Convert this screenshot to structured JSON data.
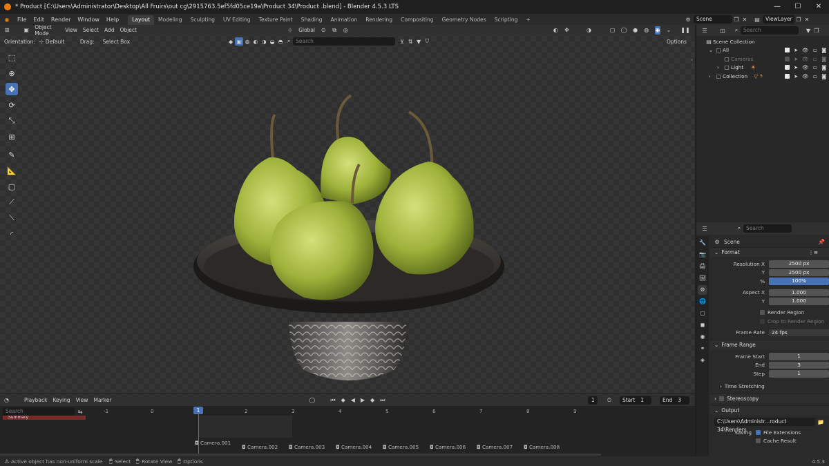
{
  "titlebar": {
    "title": "* Product [C:\\Users\\Administrator\\Desktop\\All Fruirs\\out cg\\2915763.5ef5fd05ce19a\\Product 34\\Product .blend] - Blender 4.5.3 LTS",
    "minimize": "—",
    "maximize": "☐",
    "close": "✕"
  },
  "menu": [
    "File",
    "Edit",
    "Render",
    "Window",
    "Help"
  ],
  "workspaces": [
    "Layout",
    "Modeling",
    "Sculpting",
    "UV Editing",
    "Texture Paint",
    "Shading",
    "Animation",
    "Rendering",
    "Compositing",
    "Geometry Nodes",
    "Scripting"
  ],
  "add_workspace": "+",
  "scene_name": "Scene",
  "view_layer": "ViewLayer",
  "viewport_header": {
    "mode": "Object Mode",
    "menus": [
      "View",
      "Select",
      "Add",
      "Object"
    ],
    "transform_orientation": "Global"
  },
  "tool_settings": {
    "orientation_label": "Orientation:",
    "orientation_value": "Default",
    "drag_label": "Drag:",
    "drag_value": "Select Box",
    "search_placeholder": "Search",
    "options": "Options"
  },
  "outliner": {
    "search_placeholder": "Search",
    "scene_collection": "Scene Collection",
    "items": [
      {
        "label": "All"
      },
      {
        "label": "Cameras"
      },
      {
        "label": "Light"
      },
      {
        "label": "Collection"
      }
    ],
    "collection_badge": "5"
  },
  "properties": {
    "search_placeholder": "Search",
    "context": "Scene",
    "format": {
      "header": "Format",
      "resolution_x_label": "Resolution X",
      "resolution_x": "2500 px",
      "resolution_y_label": "Y",
      "resolution_y": "2500 px",
      "percent_label": "%",
      "percent": "100%",
      "aspect_x_label": "Aspect X",
      "aspect_x": "1.000",
      "aspect_y_label": "Y",
      "aspect_y": "1.000",
      "render_region": "Render Region",
      "crop_region": "Crop to Render Region",
      "frame_rate_label": "Frame Rate",
      "frame_rate": "24 fps"
    },
    "frame_range": {
      "header": "Frame Range",
      "start_label": "Frame Start",
      "start": "1",
      "end_label": "End",
      "end": "3",
      "step_label": "Step",
      "step": "1"
    },
    "time_stretching": "Time Stretching",
    "stereoscopy": "Stereoscopy",
    "output": {
      "header": "Output",
      "path": "C:\\Users\\Administr...roduct 34\\Renders",
      "saving_label": "Saving",
      "file_extensions": "File Extensions",
      "cache_result": "Cache Result"
    }
  },
  "timeline": {
    "menus": [
      "Playback",
      "Keying",
      "View",
      "Marker"
    ],
    "current_frame": "1",
    "start_label": "Start",
    "start": "1",
    "end_label": "End",
    "end": "3",
    "search_placeholder": "Search",
    "summary": "Summary",
    "ticks": [
      "-1",
      "0",
      "1",
      "2",
      "3",
      "4",
      "5",
      "6",
      "7",
      "8",
      "9"
    ],
    "current_marker": "1",
    "cameras": [
      "Camera.001",
      "Camera.002",
      "Camera.003",
      "Camera.004",
      "Camera.005",
      "Camera.006",
      "Camera.007",
      "Camera.008"
    ]
  },
  "statusbar": {
    "message": "Active object has non-uniform scale",
    "select": "Select",
    "rotate_view": "Rotate View",
    "options": "Options",
    "version": "4.5.3"
  }
}
